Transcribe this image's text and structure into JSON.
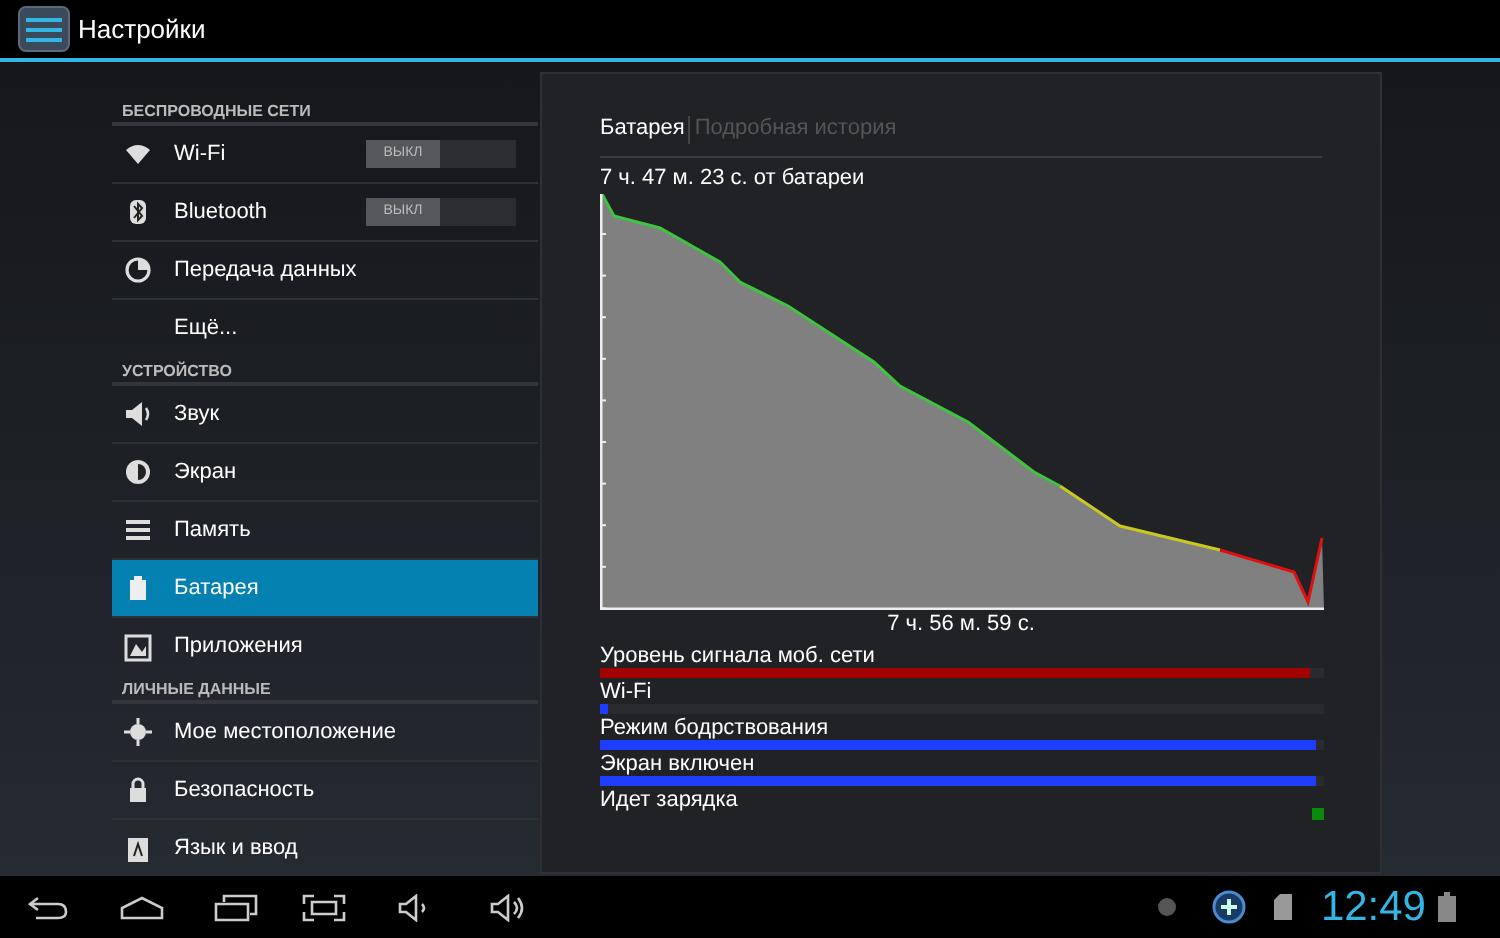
{
  "action_bar": {
    "title": "Настройки"
  },
  "sidebar": {
    "sections": [
      {
        "header": "БЕСПРОВОДНЫЕ СЕТИ",
        "items": [
          {
            "kind": "wifi",
            "label": "Wi-Fi",
            "selected": false,
            "toggle": {
              "label": "ВЫКЛ",
              "on": false
            }
          },
          {
            "kind": "bluetooth",
            "label": "Bluetooth",
            "selected": false,
            "toggle": {
              "label": "ВЫКЛ",
              "on": false
            }
          },
          {
            "kind": "data",
            "label": "Передача данных",
            "selected": false
          },
          {
            "kind": "none",
            "label": "Ещё...",
            "selected": false
          }
        ]
      },
      {
        "header": "УСТРОЙСТВО",
        "items": [
          {
            "kind": "sound",
            "label": "Звук",
            "selected": false
          },
          {
            "kind": "display",
            "label": "Экран",
            "selected": false
          },
          {
            "kind": "storage",
            "label": "Память",
            "selected": false
          },
          {
            "kind": "battery",
            "label": "Батарея",
            "selected": true
          },
          {
            "kind": "apps",
            "label": "Приложения",
            "selected": false
          }
        ]
      },
      {
        "header": "ЛИЧНЫЕ ДАННЫЕ",
        "items": [
          {
            "kind": "location",
            "label": "Мое местоположение",
            "selected": false
          },
          {
            "kind": "security",
            "label": "Безопасность",
            "selected": false
          },
          {
            "kind": "language",
            "label": "Язык и ввод",
            "selected": false
          }
        ]
      }
    ]
  },
  "panel": {
    "tabs": [
      {
        "label": "Батарея",
        "selected": true
      },
      {
        "label": "Подробная история",
        "selected": false
      }
    ],
    "graph_title": "7 ч. 47 м. 23 с. от батареи",
    "graph_duration": "7 ч. 56 м. 59 с.",
    "timelines": [
      {
        "kind": "bar",
        "label": "Уровень сигнала моб. сети",
        "level": 0.98,
        "color": "#a30000"
      },
      {
        "kind": "bar",
        "label": "Wi-Fi",
        "level": 0.01,
        "color": "#1f3dff"
      },
      {
        "kind": "bar",
        "label": "Режим бодрствования",
        "level": 0.99,
        "color": "#1f3dff"
      },
      {
        "kind": "bar",
        "label": "Экран включен",
        "level": 0.99,
        "color": "#1f3dff"
      },
      {
        "kind": "end-mark",
        "label": "Идет зарядка",
        "color": "#0a8a0a"
      }
    ]
  },
  "status_bar": {
    "clock": "12:49"
  }
}
